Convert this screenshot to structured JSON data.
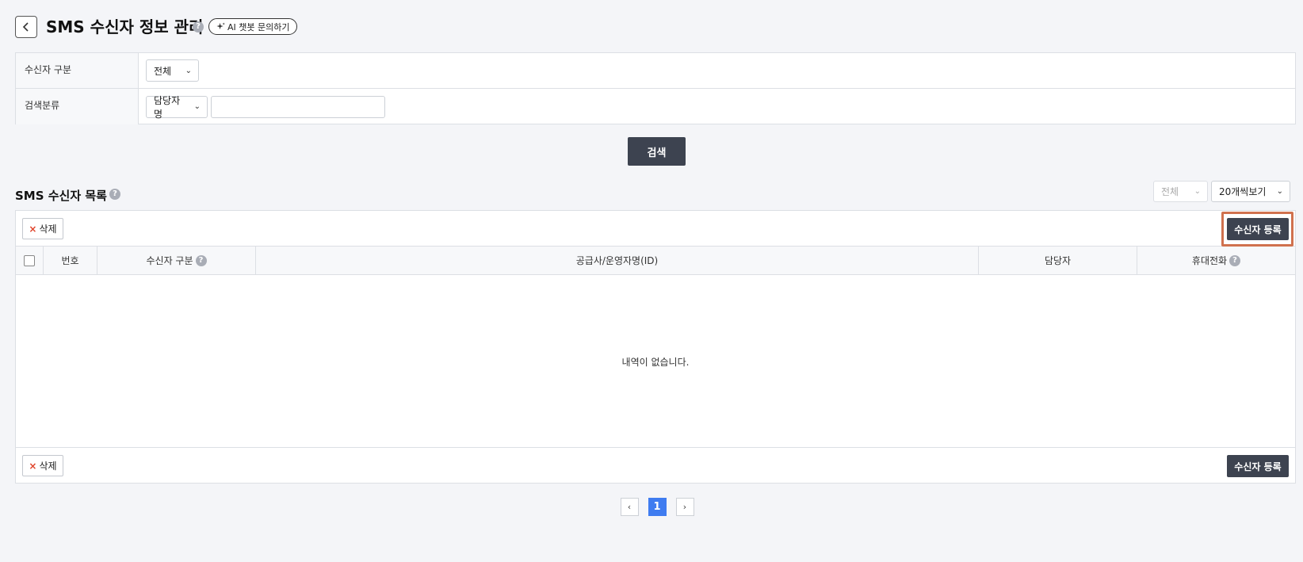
{
  "header": {
    "title": "SMS 수신자 정보 관리",
    "help": "?",
    "ai_button": "AI 챗봇 문의하기",
    "ai_icon": "sparkle-icon"
  },
  "search": {
    "row1_label": "수신자 구분",
    "row1_value": "전체",
    "row2_label": "검색분류",
    "row2_value": "담당자명",
    "keyword": "",
    "button": "검색"
  },
  "list": {
    "title": "SMS 수신자 목록",
    "help": "?",
    "filter_value": "전체",
    "page_size": "20개씩보기",
    "delete_label": "삭제",
    "delete_icon": "×",
    "register_label": "수신자 등록",
    "columns": [
      "번호",
      "수신자 구분",
      "공급사/운영자명(ID)",
      "담당자",
      "휴대전화"
    ],
    "empty_message": "내역이 없습니다."
  },
  "pagination": {
    "prev": "‹",
    "next": "›",
    "current": "1"
  },
  "colors": {
    "primary_dark": "#3d4350",
    "active_page": "#3f7cf0",
    "highlight": "#d0714e",
    "delete_x": "#e0442b"
  }
}
